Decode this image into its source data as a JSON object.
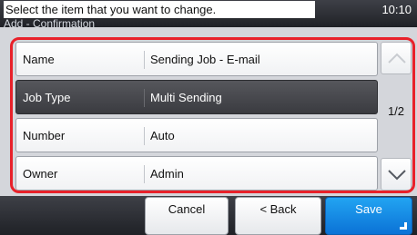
{
  "header": {
    "message": "Select the item that you want to change.",
    "time": "10:10",
    "subtitle": "Add - Confirmation"
  },
  "items": [
    {
      "label": "Name",
      "value": "Sending Job - E-mail",
      "selected": false
    },
    {
      "label": "Job Type",
      "value": "Multi Sending",
      "selected": true
    },
    {
      "label": "Number",
      "value": "Auto",
      "selected": false
    },
    {
      "label": "Owner",
      "value": "Admin",
      "selected": false
    }
  ],
  "pagination": {
    "page_indicator": "1/2",
    "scroll_up_icon": "chevron-up-icon",
    "scroll_down_icon": "chevron-down-icon"
  },
  "footer": {
    "cancel_label": "Cancel",
    "back_label": "< Back",
    "save_label": "Save"
  },
  "colors": {
    "highlight_border": "#e8212a",
    "save_button": "#1a8be6",
    "selected_row": "#48494e"
  }
}
